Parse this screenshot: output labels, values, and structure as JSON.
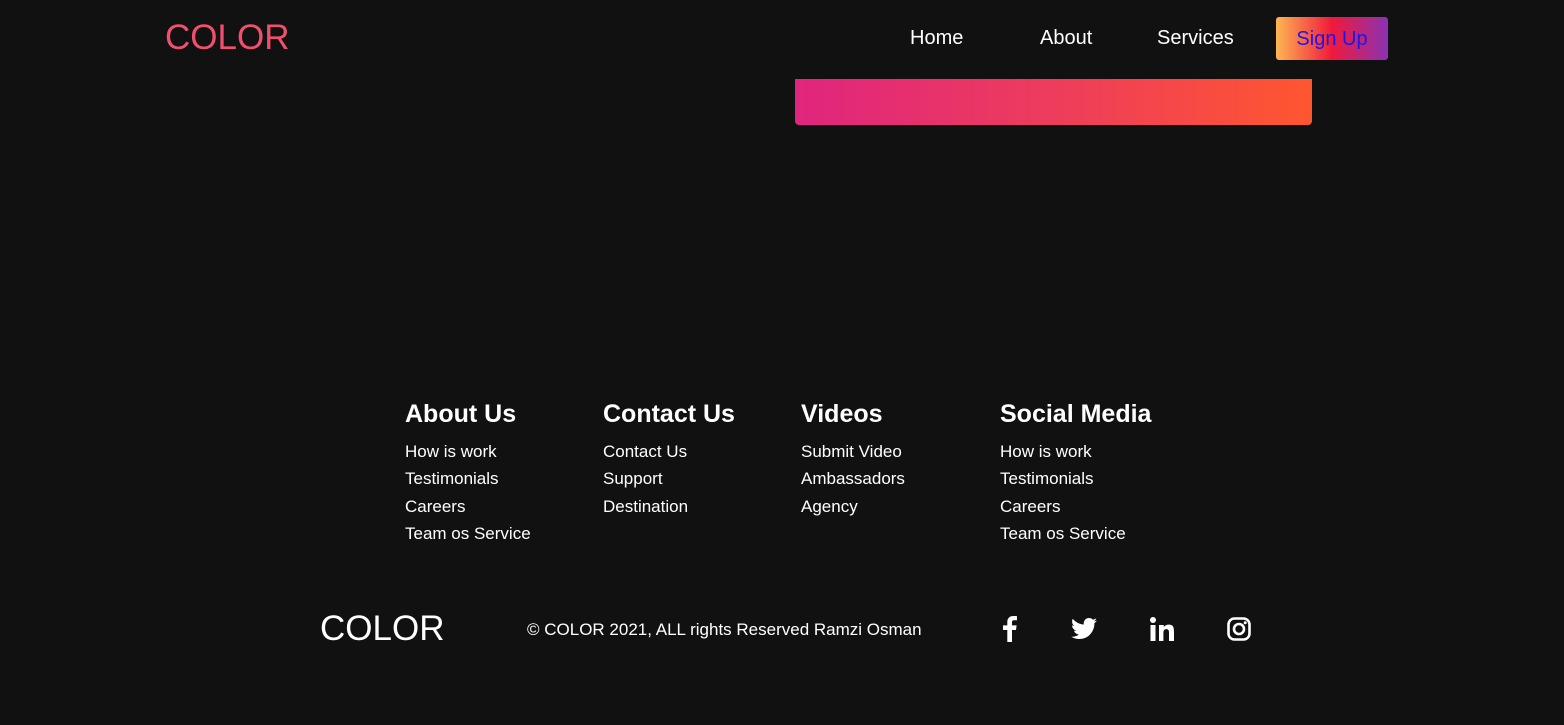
{
  "header": {
    "brand": "COLOR",
    "nav": [
      "Home",
      "About",
      "Services"
    ],
    "signup_label": "Sign Up"
  },
  "footer": {
    "columns": [
      {
        "title": "About Us",
        "links": [
          "How is work",
          "Testimonials",
          "Careers",
          "Team os Service"
        ]
      },
      {
        "title": "Contact Us",
        "links": [
          "Contact Us",
          "Support",
          "Destination"
        ]
      },
      {
        "title": "Videos",
        "links": [
          "Submit Video",
          "Ambassadors",
          "Agency"
        ]
      },
      {
        "title": "Social Media",
        "links": [
          "How is work",
          "Testimonials",
          "Careers",
          "Team os Service"
        ]
      }
    ],
    "brand": "COLOR",
    "copyright": "© COLOR 2021, ALL rights Reserved Ramzi Osman",
    "social_icons": [
      "facebook-icon",
      "twitter-icon",
      "linkedin-icon",
      "instagram-icon"
    ]
  },
  "colors": {
    "background": "#111111",
    "brand": "#f0506e",
    "signup_text": "#1d16e6"
  }
}
